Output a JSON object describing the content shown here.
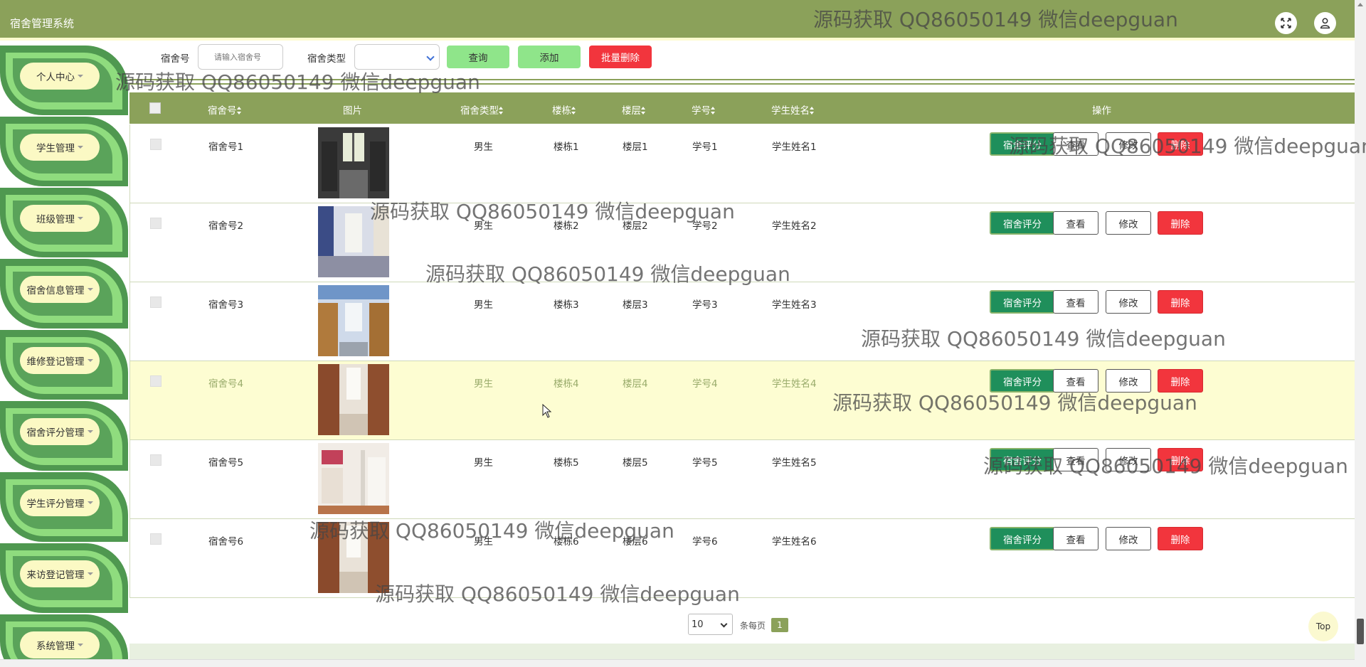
{
  "app": {
    "title": "宿舍管理系统"
  },
  "header": {
    "fullscreen_icon": "fullscreen-icon",
    "user_icon": "user-icon",
    "color": "#8ba15a"
  },
  "sidebar": {
    "items": [
      {
        "label": "个人中心"
      },
      {
        "label": "学生管理"
      },
      {
        "label": "班级管理"
      },
      {
        "label": "宿舍信息管理"
      },
      {
        "label": "维修登记管理"
      },
      {
        "label": "宿舍评分管理"
      },
      {
        "label": "学生评分管理"
      },
      {
        "label": "来访登记管理"
      },
      {
        "label": "系统管理"
      }
    ]
  },
  "search": {
    "room_label": "宿舍号",
    "room_placeholder": "请输入宿舍号",
    "type_label": "宿舍类型",
    "type_value": "",
    "query_label": "查询",
    "add_label": "添加",
    "batch_delete_label": "批量删除"
  },
  "table": {
    "headers": {
      "room": "宿舍号",
      "image": "图片",
      "type": "宿舍类型",
      "building": "楼栋",
      "floor": "楼层",
      "student_no": "学号",
      "student_name": "学生姓名",
      "actions": "操作"
    },
    "action_labels": {
      "evaluate": "宿舍评分",
      "view": "查看",
      "edit": "修改",
      "delete": "删除"
    },
    "rows": [
      {
        "room": "宿舍号1",
        "type": "男生",
        "building": "楼栋1",
        "floor": "楼层1",
        "student_no": "学号1",
        "student_name": "学生姓名1"
      },
      {
        "room": "宿舍号2",
        "type": "男生",
        "building": "楼栋2",
        "floor": "楼层2",
        "student_no": "学号2",
        "student_name": "学生姓名2"
      },
      {
        "room": "宿舍号3",
        "type": "男生",
        "building": "楼栋3",
        "floor": "楼层3",
        "student_no": "学号3",
        "student_name": "学生姓名3"
      },
      {
        "room": "宿舍号4",
        "type": "男生",
        "building": "楼栋4",
        "floor": "楼层4",
        "student_no": "学号4",
        "student_name": "学生姓名4"
      },
      {
        "room": "宿舍号5",
        "type": "男生",
        "building": "楼栋5",
        "floor": "楼层5",
        "student_no": "学号5",
        "student_name": "学生姓名5"
      },
      {
        "room": "宿舍号6",
        "type": "男生",
        "building": "楼栋6",
        "floor": "楼层6",
        "student_no": "学号6",
        "student_name": "学生姓名6"
      }
    ]
  },
  "pagination": {
    "page_size": "10",
    "per_page_label": "条每页",
    "current_page": "1"
  },
  "back_to_top": "Top",
  "watermark": "源码获取 QQ86050149 微信deepguan"
}
